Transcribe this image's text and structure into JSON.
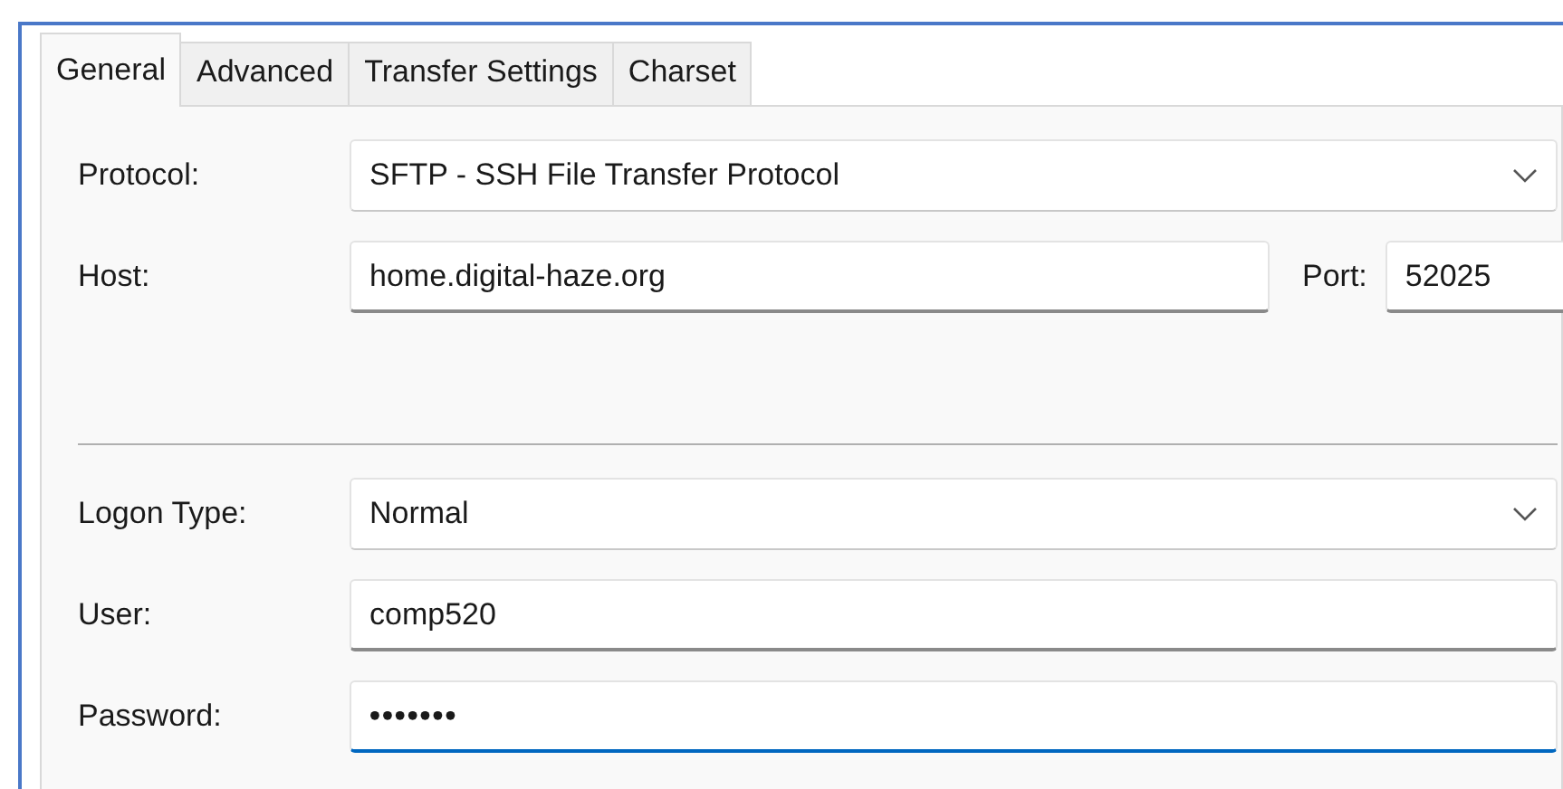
{
  "tabs": [
    {
      "label": "General",
      "selected": true
    },
    {
      "label": "Advanced",
      "selected": false
    },
    {
      "label": "Transfer Settings",
      "selected": false
    },
    {
      "label": "Charset",
      "selected": false
    }
  ],
  "protocol": {
    "label": "Protocol:",
    "value": "SFTP - SSH File Transfer Protocol"
  },
  "host": {
    "label": "Host:",
    "value": "home.digital-haze.org"
  },
  "port": {
    "label": "Port:",
    "value": "52025"
  },
  "logon_type": {
    "label": "Logon Type:",
    "value": "Normal"
  },
  "user": {
    "label": "User:",
    "value": "comp520",
    "focused": false
  },
  "password": {
    "label": "Password:",
    "value": "•••••••",
    "focused": true
  }
}
